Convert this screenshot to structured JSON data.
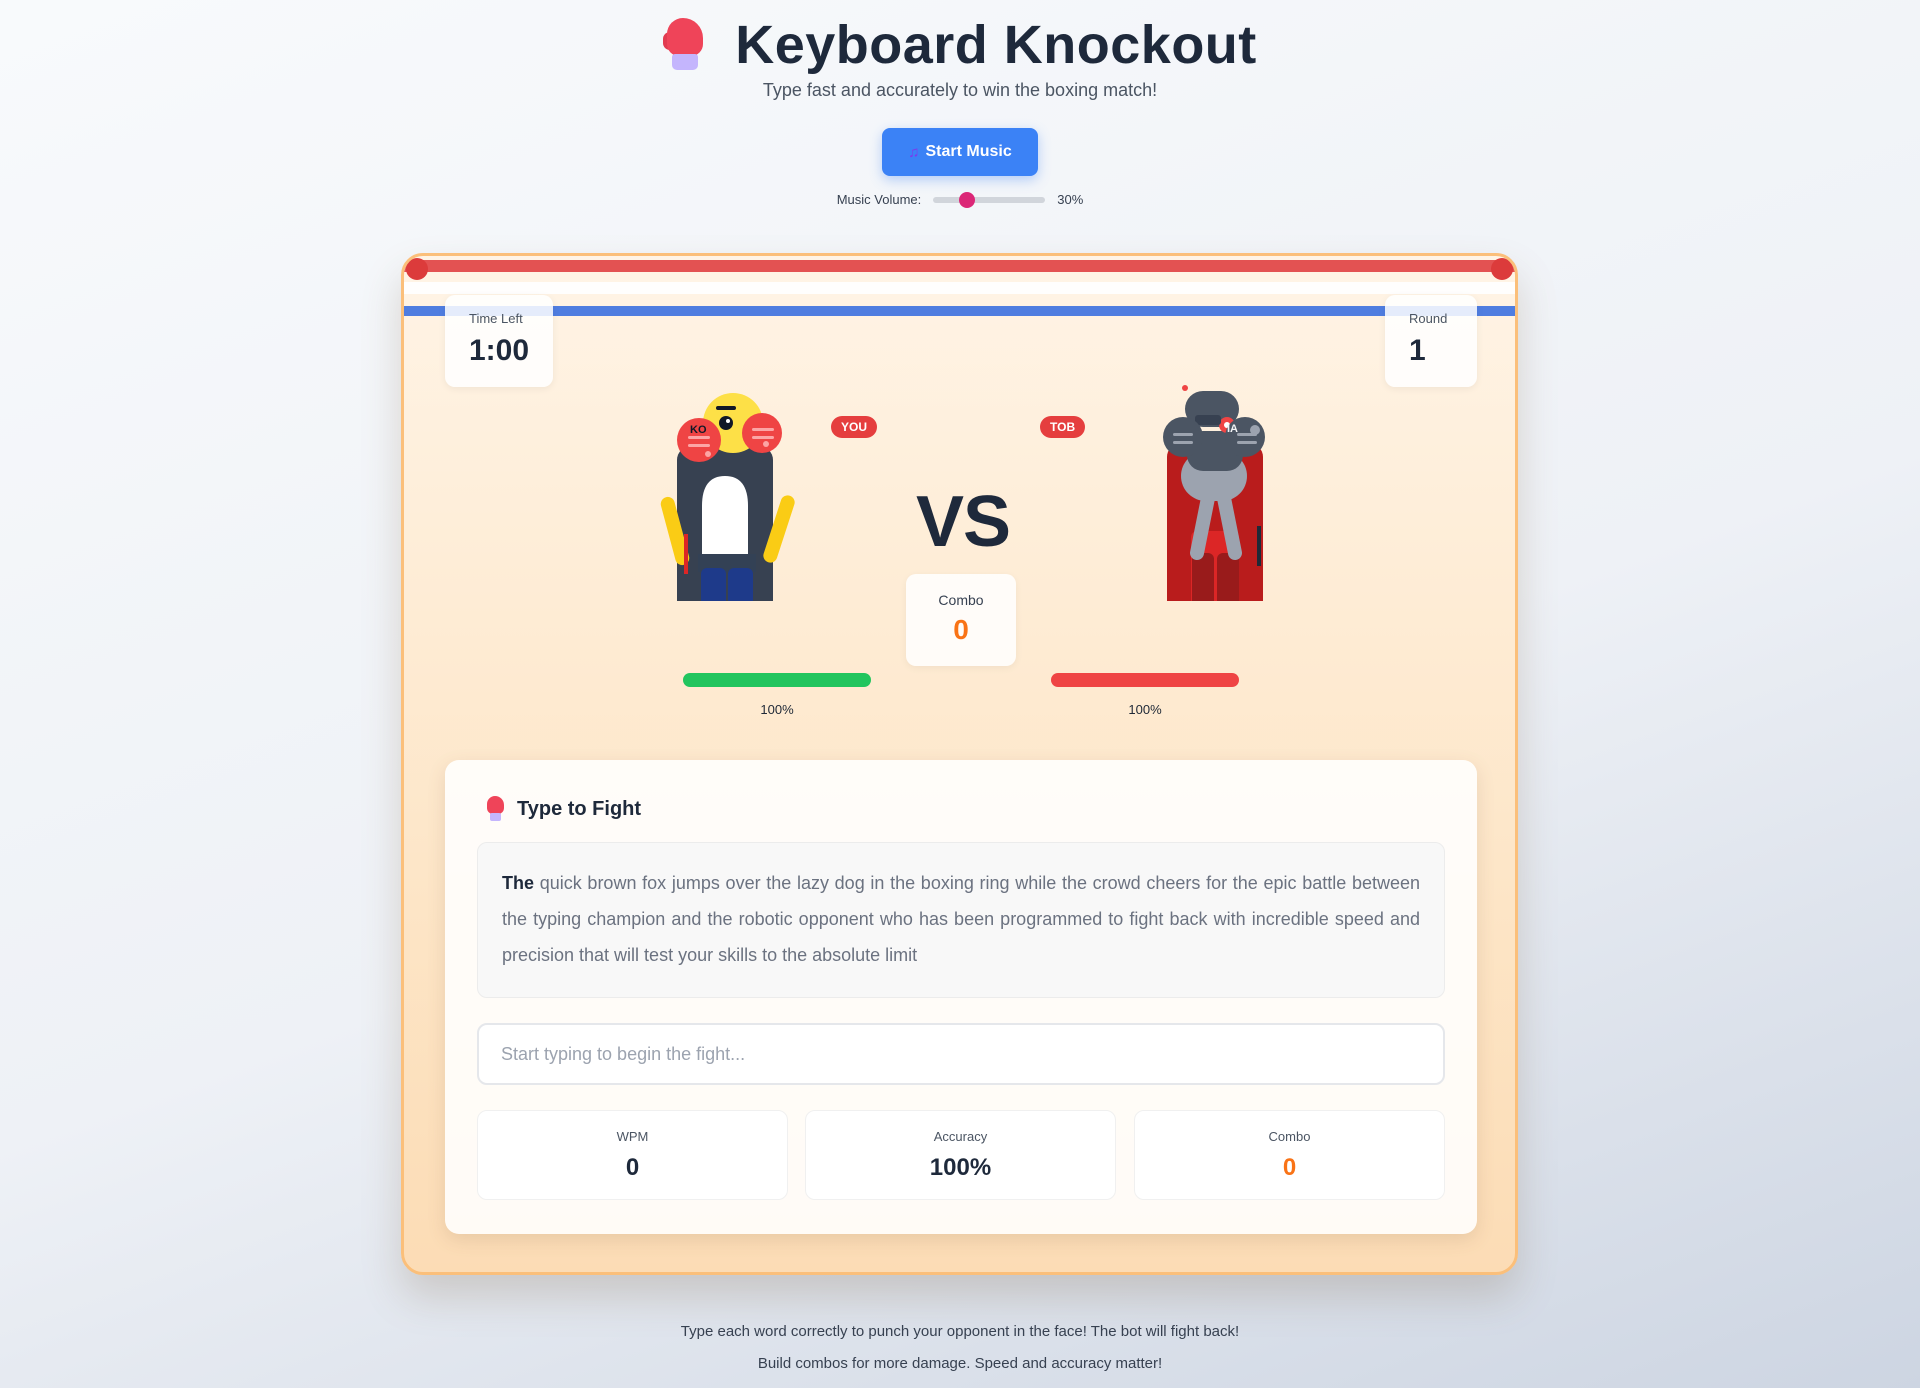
{
  "header": {
    "title": "Keyboard Knockout",
    "subtitle": "Type fast and accurately to win the boxing match!",
    "music_button_label": "Start Music",
    "music_button_icon": "music-note-icon",
    "volume_label": "Music Volume:",
    "volume_value": "30%",
    "volume_level": 0.3
  },
  "arena": {
    "time_left_label": "Time Left",
    "time_left_value": "1:00",
    "round_label": "Round",
    "round_value": "1",
    "vs_text": "VS",
    "combo_label": "Combo",
    "combo_value": "0",
    "player": {
      "badge": "YOU",
      "glove_text": "KO",
      "health_text": "100%",
      "health_level": 1.0,
      "health_color": "#22c55e"
    },
    "opponent": {
      "badge": "TOB",
      "glove_text": "IA",
      "health_text": "100%",
      "health_level": 1.0,
      "health_color": "#ef4444"
    }
  },
  "fight": {
    "title": "Type to Fight",
    "current_word": "The",
    "remaining_text": "quick brown fox jumps over the lazy dog in the boxing ring while the crowd cheers for the epic battle between the typing champion and the robotic opponent who has been programmed to fight back with incredible speed and precision that will test your skills to the absolute limit",
    "input_placeholder": "Start typing to begin the fight...",
    "stats": {
      "wpm_label": "WPM",
      "wpm_value": "0",
      "accuracy_label": "Accuracy",
      "accuracy_value": "100%",
      "combo_label": "Combo",
      "combo_value": "0"
    }
  },
  "footer": {
    "line1": "Type each word correctly to punch your opponent in the face! The bot will fight back!",
    "line2": "Build combos for more damage. Speed and accuracy matter!"
  },
  "colors": {
    "accent_blue": "#3b82f6",
    "combo_orange": "#f97316",
    "rope_red": "#e35252",
    "rope_blue": "#4f7de0"
  }
}
